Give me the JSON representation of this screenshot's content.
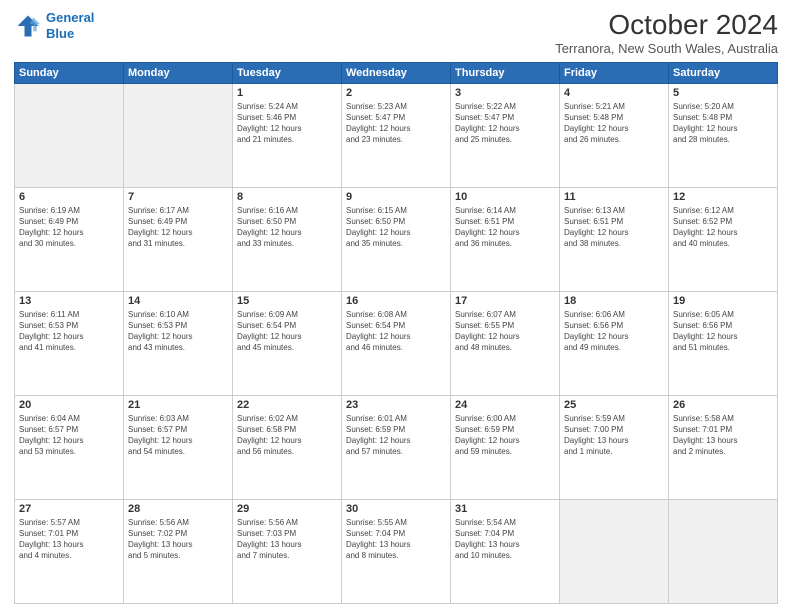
{
  "logo": {
    "line1": "General",
    "line2": "Blue"
  },
  "title": "October 2024",
  "subtitle": "Terranora, New South Wales, Australia",
  "headers": [
    "Sunday",
    "Monday",
    "Tuesday",
    "Wednesday",
    "Thursday",
    "Friday",
    "Saturday"
  ],
  "weeks": [
    [
      {
        "day": "",
        "info": ""
      },
      {
        "day": "",
        "info": ""
      },
      {
        "day": "1",
        "info": "Sunrise: 5:24 AM\nSunset: 5:46 PM\nDaylight: 12 hours\nand 21 minutes."
      },
      {
        "day": "2",
        "info": "Sunrise: 5:23 AM\nSunset: 5:47 PM\nDaylight: 12 hours\nand 23 minutes."
      },
      {
        "day": "3",
        "info": "Sunrise: 5:22 AM\nSunset: 5:47 PM\nDaylight: 12 hours\nand 25 minutes."
      },
      {
        "day": "4",
        "info": "Sunrise: 5:21 AM\nSunset: 5:48 PM\nDaylight: 12 hours\nand 26 minutes."
      },
      {
        "day": "5",
        "info": "Sunrise: 5:20 AM\nSunset: 5:48 PM\nDaylight: 12 hours\nand 28 minutes."
      }
    ],
    [
      {
        "day": "6",
        "info": "Sunrise: 6:19 AM\nSunset: 6:49 PM\nDaylight: 12 hours\nand 30 minutes."
      },
      {
        "day": "7",
        "info": "Sunrise: 6:17 AM\nSunset: 6:49 PM\nDaylight: 12 hours\nand 31 minutes."
      },
      {
        "day": "8",
        "info": "Sunrise: 6:16 AM\nSunset: 6:50 PM\nDaylight: 12 hours\nand 33 minutes."
      },
      {
        "day": "9",
        "info": "Sunrise: 6:15 AM\nSunset: 6:50 PM\nDaylight: 12 hours\nand 35 minutes."
      },
      {
        "day": "10",
        "info": "Sunrise: 6:14 AM\nSunset: 6:51 PM\nDaylight: 12 hours\nand 36 minutes."
      },
      {
        "day": "11",
        "info": "Sunrise: 6:13 AM\nSunset: 6:51 PM\nDaylight: 12 hours\nand 38 minutes."
      },
      {
        "day": "12",
        "info": "Sunrise: 6:12 AM\nSunset: 6:52 PM\nDaylight: 12 hours\nand 40 minutes."
      }
    ],
    [
      {
        "day": "13",
        "info": "Sunrise: 6:11 AM\nSunset: 6:53 PM\nDaylight: 12 hours\nand 41 minutes."
      },
      {
        "day": "14",
        "info": "Sunrise: 6:10 AM\nSunset: 6:53 PM\nDaylight: 12 hours\nand 43 minutes."
      },
      {
        "day": "15",
        "info": "Sunrise: 6:09 AM\nSunset: 6:54 PM\nDaylight: 12 hours\nand 45 minutes."
      },
      {
        "day": "16",
        "info": "Sunrise: 6:08 AM\nSunset: 6:54 PM\nDaylight: 12 hours\nand 46 minutes."
      },
      {
        "day": "17",
        "info": "Sunrise: 6:07 AM\nSunset: 6:55 PM\nDaylight: 12 hours\nand 48 minutes."
      },
      {
        "day": "18",
        "info": "Sunrise: 6:06 AM\nSunset: 6:56 PM\nDaylight: 12 hours\nand 49 minutes."
      },
      {
        "day": "19",
        "info": "Sunrise: 6:05 AM\nSunset: 6:56 PM\nDaylight: 12 hours\nand 51 minutes."
      }
    ],
    [
      {
        "day": "20",
        "info": "Sunrise: 6:04 AM\nSunset: 6:57 PM\nDaylight: 12 hours\nand 53 minutes."
      },
      {
        "day": "21",
        "info": "Sunrise: 6:03 AM\nSunset: 6:57 PM\nDaylight: 12 hours\nand 54 minutes."
      },
      {
        "day": "22",
        "info": "Sunrise: 6:02 AM\nSunset: 6:58 PM\nDaylight: 12 hours\nand 56 minutes."
      },
      {
        "day": "23",
        "info": "Sunrise: 6:01 AM\nSunset: 6:59 PM\nDaylight: 12 hours\nand 57 minutes."
      },
      {
        "day": "24",
        "info": "Sunrise: 6:00 AM\nSunset: 6:59 PM\nDaylight: 12 hours\nand 59 minutes."
      },
      {
        "day": "25",
        "info": "Sunrise: 5:59 AM\nSunset: 7:00 PM\nDaylight: 13 hours\nand 1 minute."
      },
      {
        "day": "26",
        "info": "Sunrise: 5:58 AM\nSunset: 7:01 PM\nDaylight: 13 hours\nand 2 minutes."
      }
    ],
    [
      {
        "day": "27",
        "info": "Sunrise: 5:57 AM\nSunset: 7:01 PM\nDaylight: 13 hours\nand 4 minutes."
      },
      {
        "day": "28",
        "info": "Sunrise: 5:56 AM\nSunset: 7:02 PM\nDaylight: 13 hours\nand 5 minutes."
      },
      {
        "day": "29",
        "info": "Sunrise: 5:56 AM\nSunset: 7:03 PM\nDaylight: 13 hours\nand 7 minutes."
      },
      {
        "day": "30",
        "info": "Sunrise: 5:55 AM\nSunset: 7:04 PM\nDaylight: 13 hours\nand 8 minutes."
      },
      {
        "day": "31",
        "info": "Sunrise: 5:54 AM\nSunset: 7:04 PM\nDaylight: 13 hours\nand 10 minutes."
      },
      {
        "day": "",
        "info": ""
      },
      {
        "day": "",
        "info": ""
      }
    ]
  ]
}
